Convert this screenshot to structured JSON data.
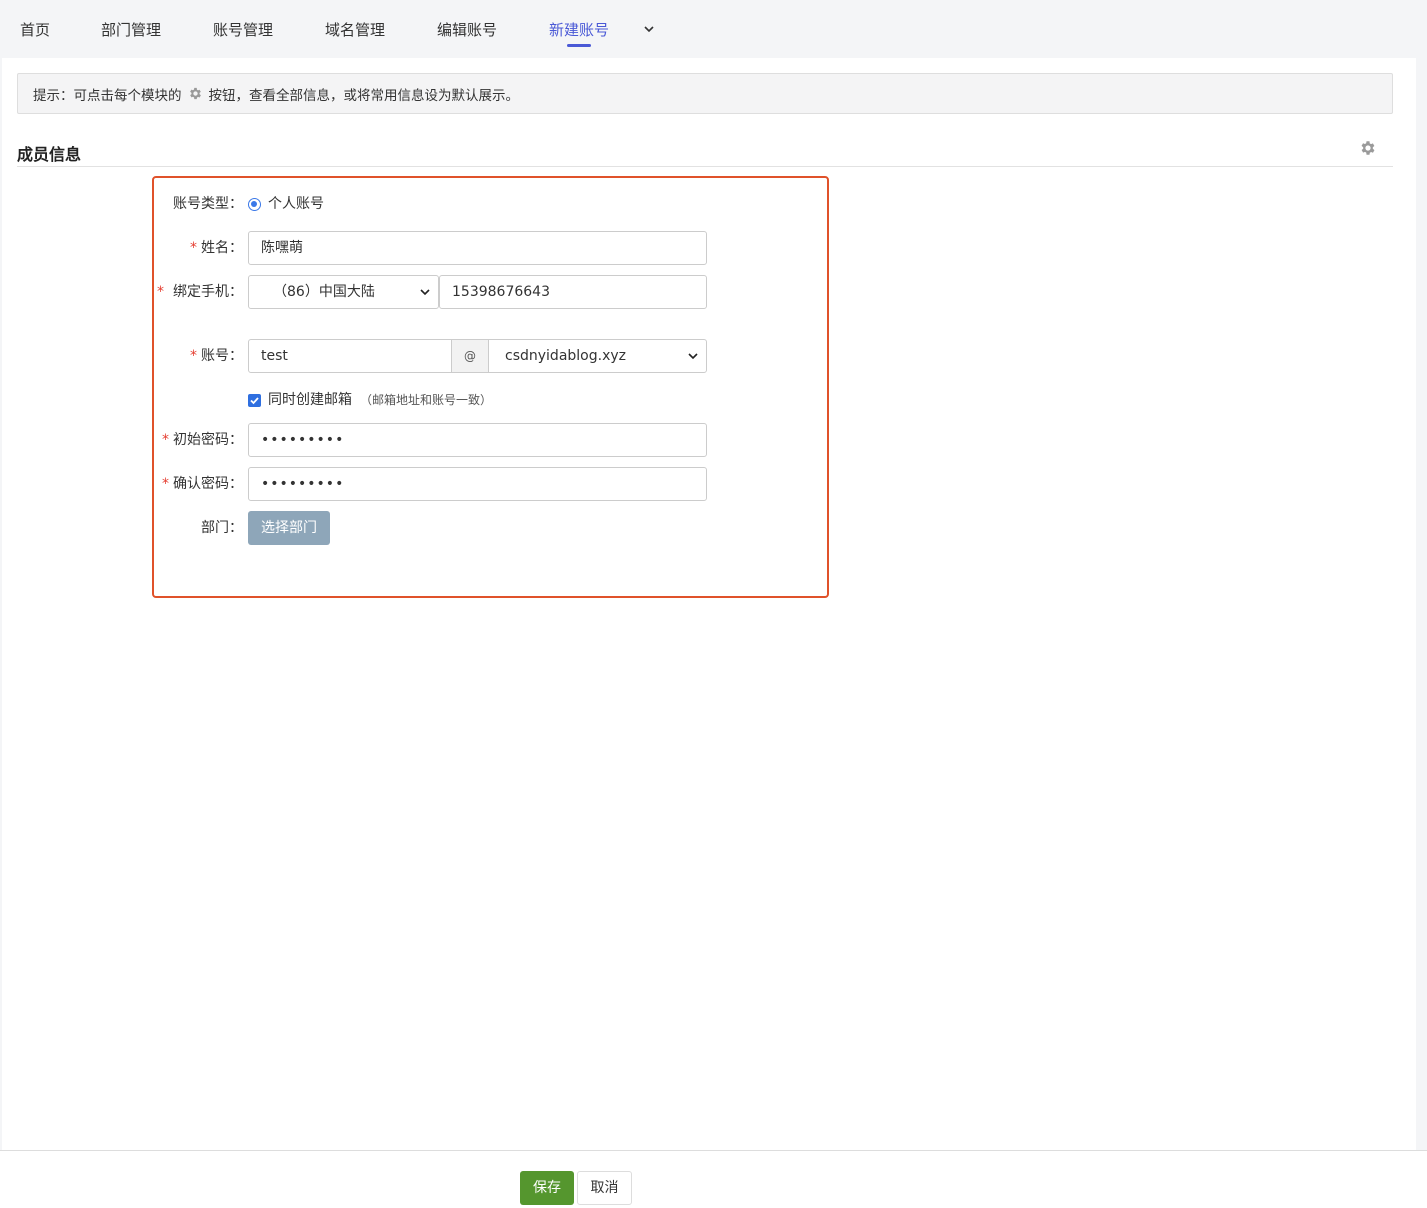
{
  "tabs": [
    {
      "label": "首页",
      "active": false
    },
    {
      "label": "部门管理",
      "active": false
    },
    {
      "label": "账号管理",
      "active": false
    },
    {
      "label": "域名管理",
      "active": false
    },
    {
      "label": "编辑账号",
      "active": false
    },
    {
      "label": "新建账号",
      "active": true
    }
  ],
  "accent_color": "#4a59d6",
  "hint": {
    "prefix": "提示：可点击每个模块的",
    "suffix": "按钮，查看全部信息，或将常用信息设为默认展示。"
  },
  "section": {
    "title": "成员信息"
  },
  "form": {
    "account_type": {
      "label": "账号类型：",
      "option": "个人账号",
      "selected": true
    },
    "name": {
      "label": "姓名：",
      "required": true,
      "value": "陈嘿萌"
    },
    "phone": {
      "label": "绑定手机：",
      "required": true,
      "country": "（86）中国大陆",
      "value": "15398676643"
    },
    "account": {
      "label": "账号：",
      "required": true,
      "value": "test",
      "at": "@",
      "domain": "csdnyidablog.xyz"
    },
    "create_mailbox": {
      "label": "同时创建邮箱",
      "note": "（邮箱地址和账号一致）",
      "checked": true
    },
    "initial_password": {
      "label": "初始密码：",
      "required": true,
      "value": "•••••••••"
    },
    "confirm_password": {
      "label": "确认密码：",
      "required": true,
      "value": "•••••••••"
    },
    "department": {
      "label": "部门：",
      "button": "选择部门"
    }
  },
  "footer": {
    "save": "保存",
    "cancel": "取消"
  },
  "colors": {
    "highlight_border": "#e0522a",
    "save_button": "#55962e",
    "required_mark": "#e53d30"
  }
}
